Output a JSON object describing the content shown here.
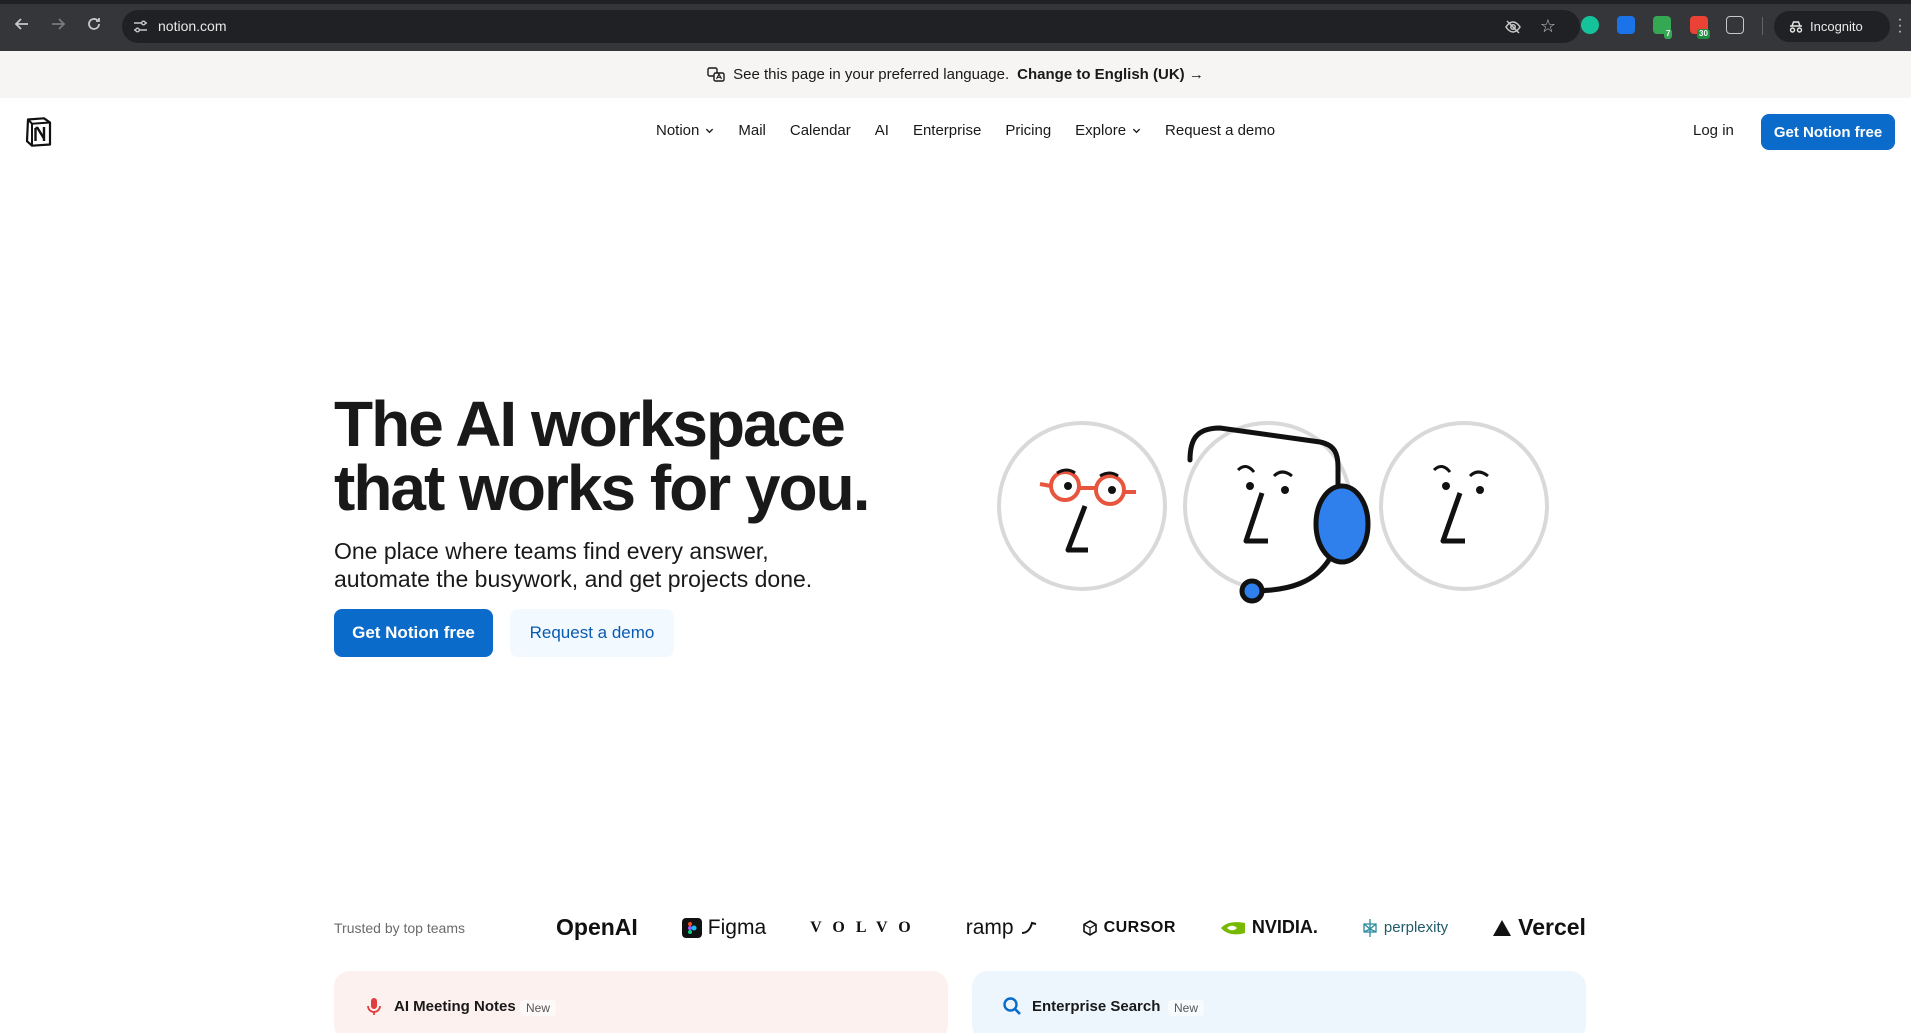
{
  "browser": {
    "url": "notion.com",
    "incognito_label": "Incognito",
    "ext_badges": [
      "7",
      "30"
    ]
  },
  "banner": {
    "text": "See this page in your preferred language.",
    "cta": "Change to English (UK) →"
  },
  "nav": {
    "items": [
      {
        "label": "Notion",
        "dropdown": true
      },
      {
        "label": "Mail",
        "dropdown": false
      },
      {
        "label": "Calendar",
        "dropdown": false
      },
      {
        "label": "AI",
        "dropdown": false
      },
      {
        "label": "Enterprise",
        "dropdown": false
      },
      {
        "label": "Pricing",
        "dropdown": false
      },
      {
        "label": "Explore",
        "dropdown": true
      },
      {
        "label": "Request a demo",
        "dropdown": false
      }
    ],
    "login": "Log in",
    "cta": "Get Notion free"
  },
  "hero": {
    "title_line1": "The AI workspace",
    "title_line2": "that works for you.",
    "sub_line1": "One place where teams find every answer,",
    "sub_line2": "automate the busywork, and get projects done.",
    "primary": "Get Notion free",
    "secondary": "Request a demo"
  },
  "trusted": {
    "label": "Trusted by top teams",
    "brands": [
      "OpenAI",
      "Figma",
      "VOLVO",
      "ramp",
      "CURSOR",
      "NVIDIA.",
      "perplexity",
      "Vercel"
    ]
  },
  "cards": [
    {
      "title": "AI Meeting Notes",
      "badge": "New"
    },
    {
      "title": "Enterprise Search",
      "badge": "New"
    }
  ],
  "colors": {
    "accent": "#0b6bcb",
    "chrome": "#35363a",
    "banner": "#f6f5f4"
  }
}
